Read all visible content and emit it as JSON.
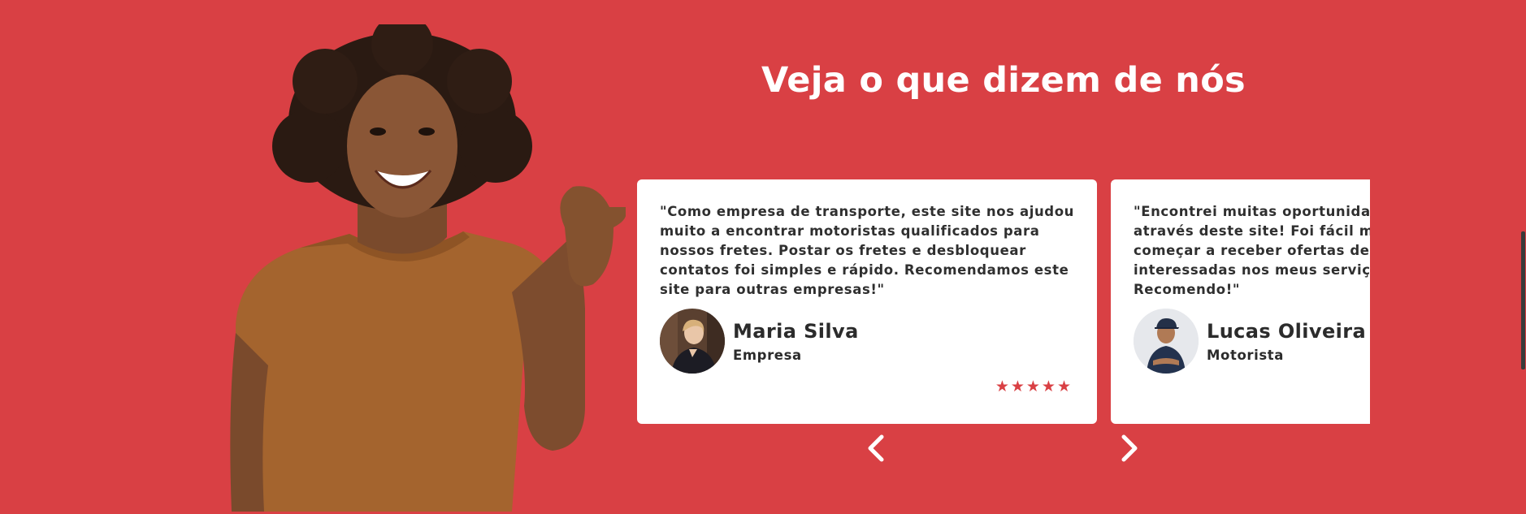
{
  "section": {
    "heading": "Veja o que dizem de nós",
    "accent_color": "#d94044"
  },
  "hero_image": {
    "icon": "smiling-woman-pointing-photo"
  },
  "testimonials": [
    {
      "quote": "\"Como empresa de transporte, este site nos ajudou muito a encontrar motoristas qualificados para nossos fretes. Postar os fretes e desbloquear contatos foi simples e rápido. Recomendamos este site para outras empresas!\"",
      "name": "Maria Silva",
      "role": "Empresa",
      "avatar_icon": "woman-avatar-photo",
      "stars": "★★★★★",
      "rating": 5
    },
    {
      "quote": "\"Encontrei muitas oportunidades de trabalho através deste site! Foi fácil me cadastrar e começar a receber ofertas de empresas interessadas nos meus serviços como motorista. Recomendo!\"",
      "name": "Lucas Oliveira",
      "role": "Motorista",
      "avatar_icon": "man-avatar-photo",
      "stars": "",
      "rating": null
    }
  ],
  "controls": {
    "prev_icon": "chevron-left-icon",
    "next_icon": "chevron-right-icon"
  }
}
